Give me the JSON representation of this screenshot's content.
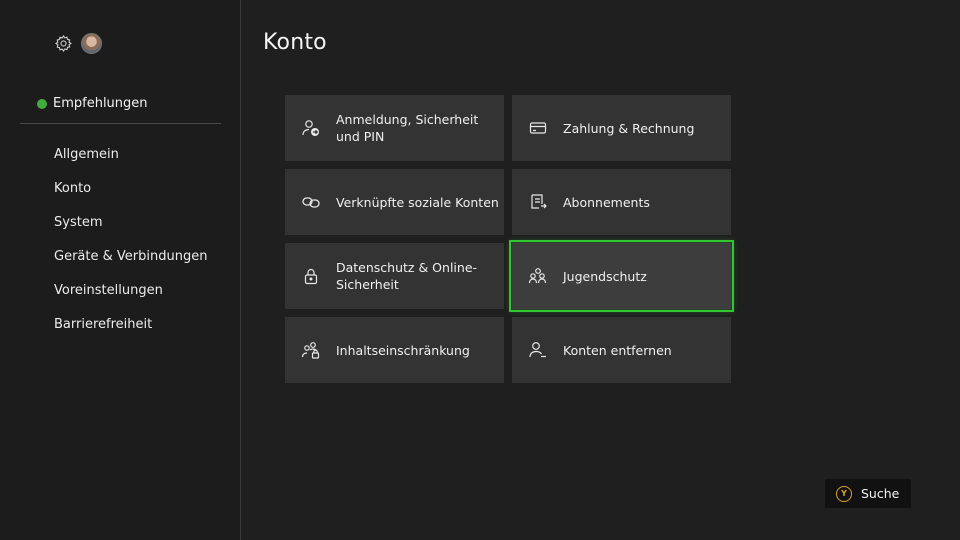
{
  "sidebar": {
    "recommendations": "Empfehlungen",
    "accent_color": "#3fae3f",
    "items": [
      {
        "label": "Allgemein"
      },
      {
        "label": "Konto"
      },
      {
        "label": "System"
      },
      {
        "label": "Geräte & Verbindungen"
      },
      {
        "label": "Voreinstellungen"
      },
      {
        "label": "Barrierefreiheit"
      }
    ]
  },
  "header": {
    "title": "Konto"
  },
  "tiles": [
    {
      "label": "Anmeldung, Sicherheit und PIN",
      "icon": "person-arrow-icon"
    },
    {
      "label": "Zahlung & Rechnung",
      "icon": "credit-card-icon"
    },
    {
      "label": "Verknüpfte soziale Konten",
      "icon": "link-icon"
    },
    {
      "label": "Abonnements",
      "icon": "subscription-icon"
    },
    {
      "label": "Datenschutz & Online-Sicherheit",
      "icon": "lock-icon"
    },
    {
      "label": "Jugendschutz",
      "icon": "family-icon",
      "focused": true
    },
    {
      "label": "Inhaltseinschränkung",
      "icon": "people-lock-icon"
    },
    {
      "label": "Konten entfernen",
      "icon": "person-remove-icon"
    }
  ],
  "focus_color": "#31c531",
  "footer": {
    "search_button_glyph": "Y",
    "search_label": "Suche",
    "button_color": "#e0a030"
  }
}
